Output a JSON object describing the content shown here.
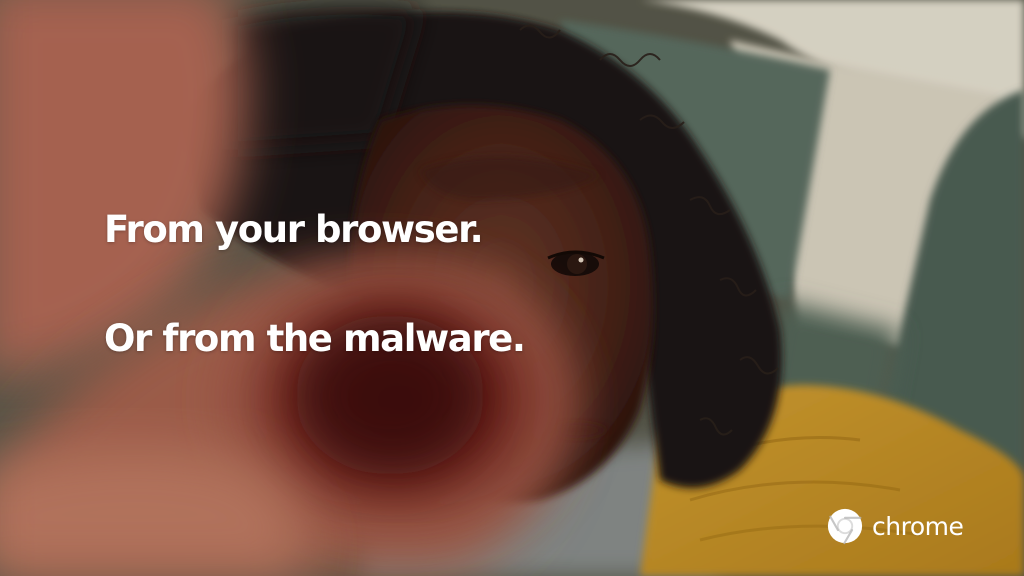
{
  "video_frame": {
    "headline_line1": "From your browser.",
    "headline_line2": "Or from the malware.",
    "brand": {
      "name": "chrome",
      "icon": "chrome-logo-icon"
    }
  }
}
